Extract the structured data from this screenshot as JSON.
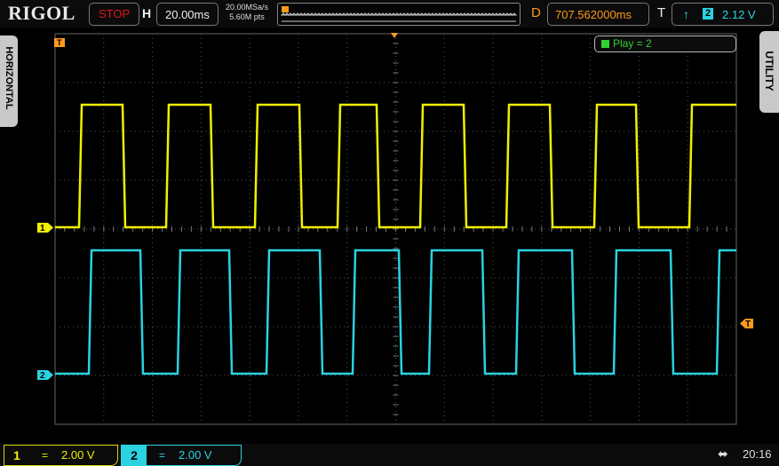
{
  "header": {
    "brand": "RIGOL",
    "run_status": "STOP",
    "horizontal_label": "H",
    "timebase": "20.00ms",
    "sample_rate": "20.00MSa/s",
    "memory_depth": "5.60M pts",
    "delay_label": "D",
    "delay_value": "707.562000ms",
    "trigger_label": "T",
    "trigger_source": "2",
    "trigger_level": "2.12 V"
  },
  "side_tabs": {
    "left": "HORIZONTAL",
    "right": "UTILITY"
  },
  "overlay": {
    "play_status": "Play = 2"
  },
  "markers": {
    "ch1_ground": "1",
    "ch2_ground": "2",
    "trigger_marker": "T"
  },
  "channels": [
    {
      "id": "1",
      "coupling": "=",
      "scale": "2.00 V",
      "color": "#f0f000"
    },
    {
      "id": "2",
      "coupling": "=",
      "scale": "2.00 V",
      "color": "#2bd2e0"
    }
  ],
  "status": {
    "clock": "20:16"
  },
  "colors": {
    "ch1": "#f0f000",
    "ch2": "#2bd2e0",
    "accent": "#ff9a1e",
    "play": "#2fd12f",
    "stop": "#e01818"
  },
  "icons": {
    "usb": "usb-icon",
    "trigger_edge": "rising-edge-icon"
  }
}
